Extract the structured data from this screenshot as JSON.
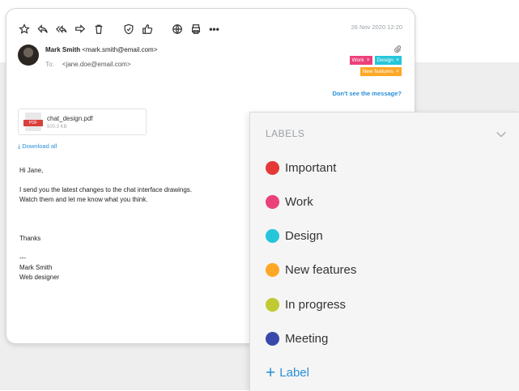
{
  "email": {
    "date": "26 Nov 2020 12:20",
    "sender": {
      "name": "Mark Smith",
      "email": "<mark.smith@email.com>"
    },
    "to_label": "To:",
    "to": "<jane.doe@email.com>",
    "tags": [
      {
        "label": "Work",
        "color": "#ec407a"
      },
      {
        "label": "Design",
        "color": "#26c6da"
      },
      {
        "label": "New features",
        "color": "#ffa726"
      }
    ],
    "tag_remove": "×",
    "dont_see": "Don't see the message?",
    "attachment": {
      "name": "chat_design.pdf",
      "size": "500.3 KB",
      "type_label": "PDF"
    },
    "download_all": "⤓ Download all",
    "body_lines": [
      "Hi Jane,",
      "",
      "I send you the latest changes to the chat interface drawings.",
      "Watch them and let me know what you think.",
      "",
      "",
      "",
      "Thanks",
      "",
      "---",
      "Mark Smith",
      "Web designer"
    ]
  },
  "labels_panel": {
    "header": "LABELS",
    "items": [
      {
        "label": "Important",
        "color": "#e53935"
      },
      {
        "label": "Work",
        "color": "#ec407a"
      },
      {
        "label": "Design",
        "color": "#26c6da"
      },
      {
        "label": "New features",
        "color": "#ffa726"
      },
      {
        "label": "In progress",
        "color": "#c0ca33"
      },
      {
        "label": "Meeting",
        "color": "#3949ab"
      }
    ],
    "add_label": "Label"
  }
}
